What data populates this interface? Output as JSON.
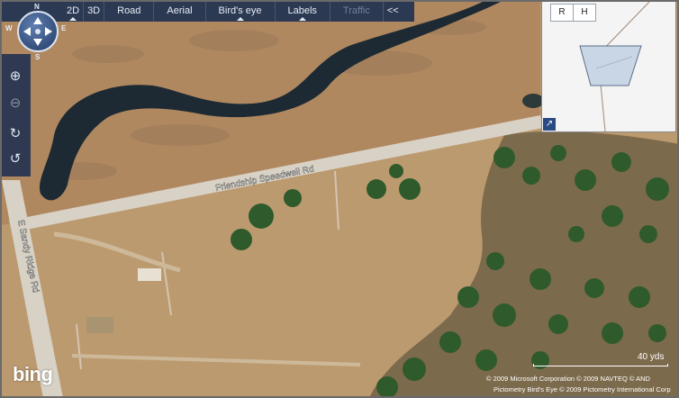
{
  "toolbar": {
    "items": [
      "2D",
      "3D",
      "Road",
      "Aerial",
      "Bird's eye",
      "Labels",
      "Traffic",
      "<<"
    ]
  },
  "compass": {
    "n": "N",
    "s": "S",
    "e": "E",
    "w": "W"
  },
  "roads": {
    "friendship": "Friendship Speedwell Rd",
    "sandy_ridge": "E Sandy Ridge Rd"
  },
  "minimap": {
    "btn_r": "R",
    "btn_h": "H",
    "expand": "↗"
  },
  "footer": {
    "logo": "bing",
    "scale": "40 yds",
    "copyright1": "© 2009 Microsoft Corporation   © 2009 NAVTEQ   © AND",
    "copyright2": "Pictometry Bird's Eye © 2009 Pictometry International Corp"
  },
  "colors": {
    "field": "#b9956a",
    "marsh": "#b58a5e",
    "water": "#1d2a33",
    "road": "#d8d2c6",
    "trees": "#2f5a2c",
    "toolbar": "#192d50"
  }
}
